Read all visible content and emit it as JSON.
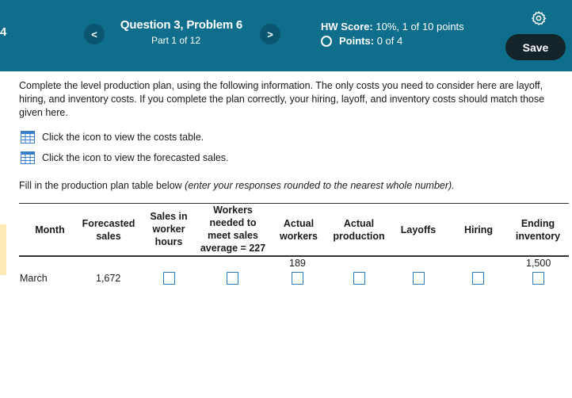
{
  "header": {
    "edge_number": "4",
    "question_title": "Question 3, Problem 6",
    "part_label": "Part 1 of 12",
    "hw_score_label": "HW Score:",
    "hw_score_value": "10%, 1 of 10 points",
    "points_label": "Points:",
    "points_value": "0 of 4",
    "save_label": "Save",
    "prev_label": "<",
    "next_label": ">"
  },
  "instructions": "Complete the level production plan, using the following information. The only costs you need to consider here are layoff, hiring, and inventory costs. If you complete the plan correctly, your hiring, layoff, and inventory costs should match those given here.",
  "links": {
    "costs_table": "Click the icon to view the costs table.",
    "forecasted_sales": "Click the icon to view the forecasted sales."
  },
  "fill_prompt": "Fill in the production plan table below",
  "fill_prompt_italic": "(enter your responses rounded to the nearest whole number).",
  "table": {
    "headers": {
      "month": "Month",
      "forecasted_1": "Forecasted",
      "forecasted_2": "sales",
      "sales_hours_1": "Sales in",
      "sales_hours_2": "worker",
      "sales_hours_3": "hours",
      "workers_needed_1": "Workers",
      "workers_needed_2": "needed to",
      "workers_needed_3": "meet sales",
      "workers_needed_4": "average = 227",
      "actual_workers_1": "Actual",
      "actual_workers_2": "workers",
      "actual_production_1": "Actual",
      "actual_production_2": "production",
      "layoffs": "Layoffs",
      "hiring": "Hiring",
      "ending_1": "Ending",
      "ending_2": "inventory"
    },
    "initial_workers": "189",
    "initial_inventory": "1,500",
    "rows": [
      {
        "month": "March",
        "forecasted_sales": "1,672"
      }
    ]
  },
  "colors": {
    "header_bg": "#0e6e8c",
    "save_bg": "#13242b",
    "input_border": "#2d7fc1",
    "icon_blue": "#3a7dc9"
  }
}
